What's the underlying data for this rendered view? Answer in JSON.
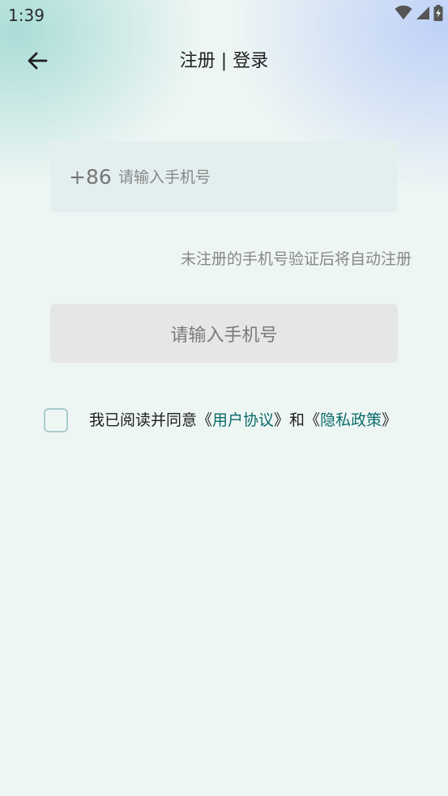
{
  "status_bar": {
    "time": "1:39"
  },
  "header": {
    "title": "注册 | 登录"
  },
  "phone": {
    "country_code": "+86",
    "placeholder": "请输入手机号",
    "value": ""
  },
  "hint_text": "未注册的手机号验证后将自动注册",
  "submit_button_label": "请输入手机号",
  "agreement": {
    "prefix": "我已阅读并同意",
    "open1": "《",
    "link1": "用户协议",
    "mid": "》和《",
    "link2": "隐私政策",
    "close": "》",
    "checked": false
  },
  "colors": {
    "link": "#0c6b6b",
    "button_bg": "#e5e6e6",
    "input_bg": "#e3efee",
    "checkbox_border": "#a8cdcb"
  }
}
